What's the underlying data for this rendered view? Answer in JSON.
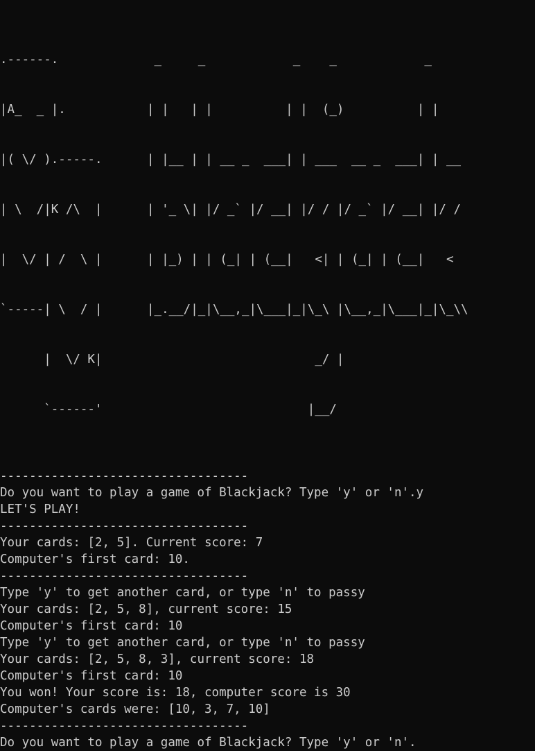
{
  "banner": {
    "card_art": [
      ".------.",
      "|A_  _ |.",
      "|( \\/ ).-----.",
      "| \\  /|K /\\  |",
      "|  \\/ | /  \\ |",
      "`-----| \\  / |",
      "      |  \\/ K|",
      "      `------'"
    ],
    "title_art": [
      " _     _            _    _            _    ",
      "| |   | |          | |  (_)          | |   ",
      "| |__ | | __ _  ___| | ___  __ _  ___| | __",
      "| '_ \\| |/ _` |/ __| |/ / |/ _` |/ __| |/ /",
      "| |_) | | (_| | (__|   <| | (_| | (__|   < ",
      "|_.__/|_|\\__,_|\\___|_|\\_\\ |\\__,_|\\___|_|\\_\\\\",
      "                       _/ |                ",
      "                      |__/                 "
    ]
  },
  "console_lines": [
    "",
    "----------------------------------",
    "Do you want to play a game of Blackjack? Type 'y' or 'n'.y",
    "LET'S PLAY!",
    "----------------------------------",
    "Your cards: [2, 5]. Current score: 7",
    "Computer's first card: 10.",
    "----------------------------------",
    "Type 'y' to get another card, or type 'n' to passy",
    "Your cards: [2, 5, 8], current score: 15",
    "Computer's first card: 10",
    "Type 'y' to get another card, or type 'n' to passy",
    "Your cards: [2, 5, 8, 3], current score: 18",
    "Computer's first card: 10",
    "You won! Your score is: 18, computer score is 30",
    "Computer's cards were: [10, 3, 7, 10]",
    "----------------------------------",
    "Do you want to play a game of Blackjack? Type 'y' or 'n'."
  ]
}
